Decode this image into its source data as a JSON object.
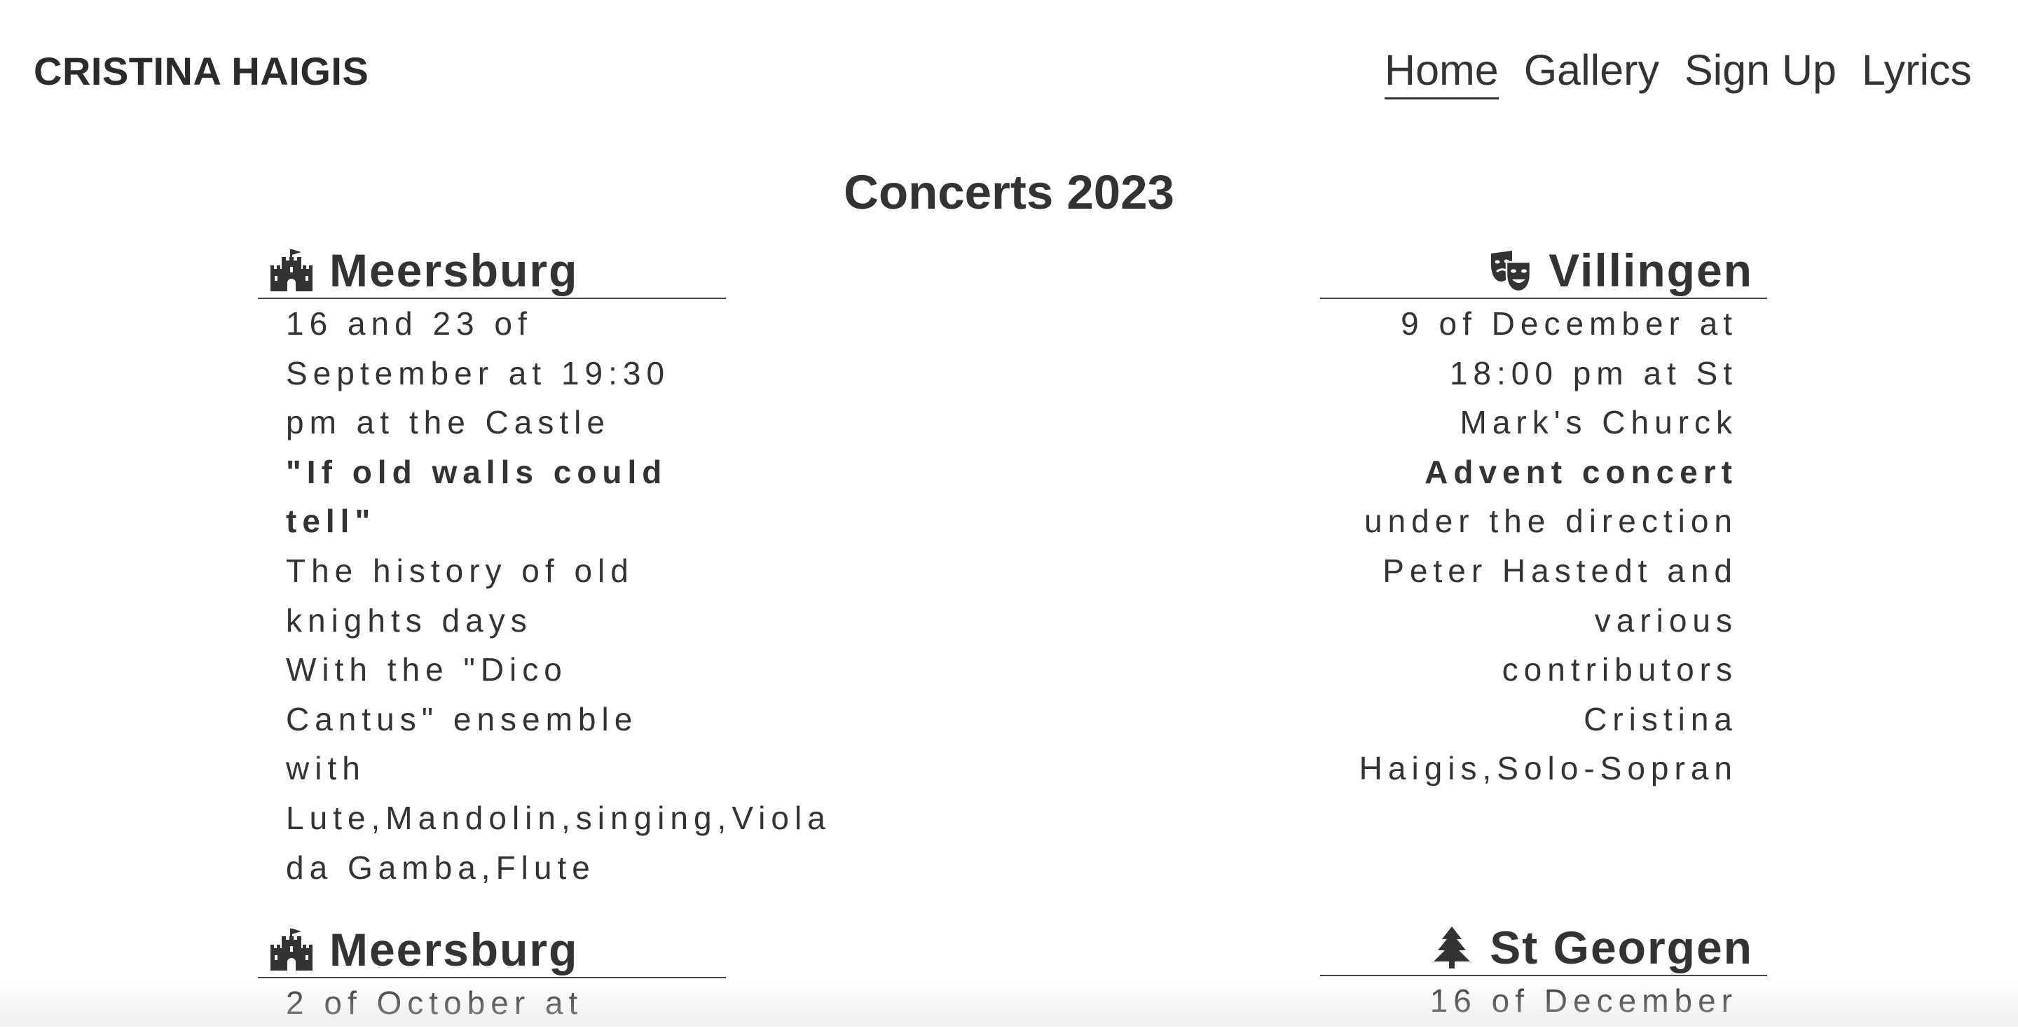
{
  "header": {
    "brand": "CRISTINA HAIGIS",
    "nav": [
      {
        "label": "Home",
        "active": true
      },
      {
        "label": "Gallery",
        "active": false
      },
      {
        "label": "Sign Up",
        "active": false
      },
      {
        "label": "Lyrics",
        "active": false
      }
    ]
  },
  "main": {
    "title": "Concerts 2023",
    "concerts": [
      {
        "city": "Meersburg",
        "icon": "castle-icon",
        "lines": [
          "16 and 23 of",
          "September at 19:30",
          "pm at the Castle",
          "\"If old walls could",
          "tell\"",
          "The history of old",
          "knights days",
          "With the \"Dico",
          "Cantus\" ensemble",
          "with",
          "Lute,Mandolin,singing,Viola",
          "da Gamba,Flute"
        ]
      },
      {
        "city": "Villingen",
        "icon": "theater-masks-icon",
        "lines": [
          "9 of December at",
          "18:00 pm at St",
          "Mark's Churck",
          "Advent concert",
          "under the direction",
          "Peter Hastedt and",
          "various",
          "contributors",
          "Cristina",
          "Haigis,Solo-Sopran"
        ]
      },
      {
        "city": "Meersburg",
        "icon": "castle-icon",
        "lines": [
          "2 of October at"
        ]
      },
      {
        "city": "St Georgen",
        "icon": "tree-icon",
        "lines": [
          "16 of December"
        ]
      }
    ]
  },
  "colors": {
    "text": "#333333",
    "background": "#ffffff",
    "rule": "#444444"
  }
}
